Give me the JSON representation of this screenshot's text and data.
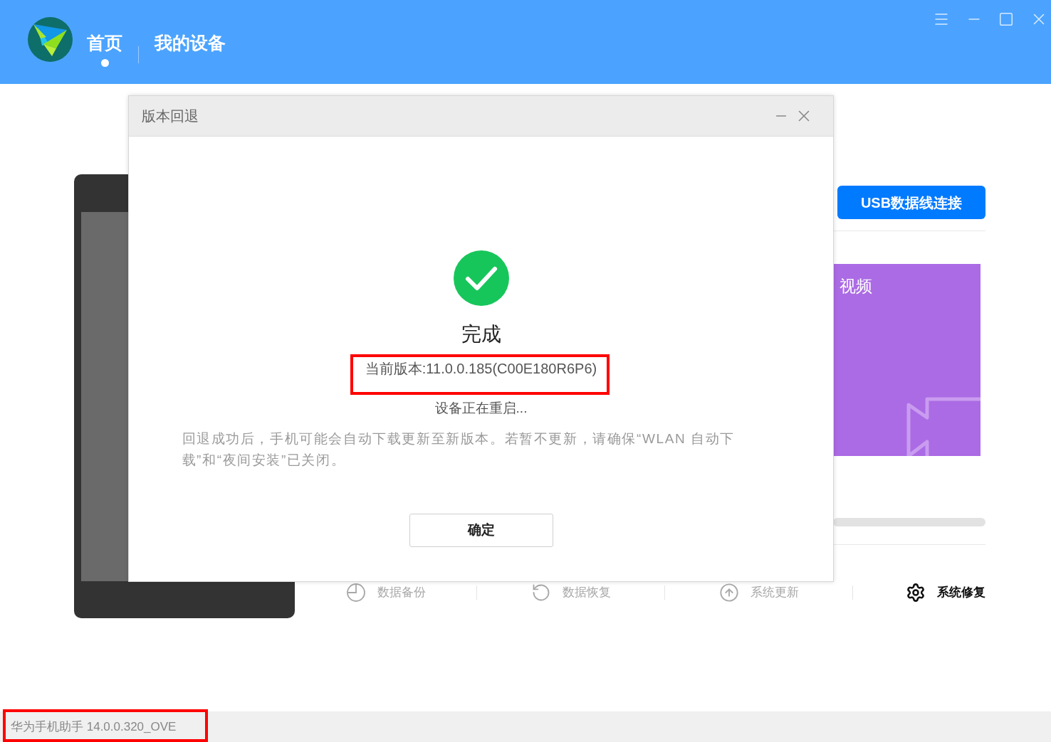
{
  "header": {
    "tabs": [
      {
        "label": "首页",
        "selected": true
      },
      {
        "label": "我的设备",
        "selected": false
      }
    ]
  },
  "connect_button": "USB数据线连接",
  "media_card": {
    "title": "视频"
  },
  "toolbar": [
    {
      "label": "数据备份",
      "disabled": true
    },
    {
      "label": "数据恢复",
      "disabled": true
    },
    {
      "label": "系统更新",
      "disabled": true
    },
    {
      "label": "系统修复",
      "disabled": false
    }
  ],
  "dialog": {
    "title": "版本回退",
    "status": "完成",
    "version": "当前版本:11.0.0.185(C00E180R6P6)",
    "progress_text": "设备正在重启...",
    "notice": "回退成功后，手机可能会自动下载更新至新版本。若暂不更新，请确保“WLAN 自动下载”和“夜间安装”已关闭。",
    "button": "确定"
  },
  "status_bar": "华为手机助手 14.0.0.320_OVE"
}
